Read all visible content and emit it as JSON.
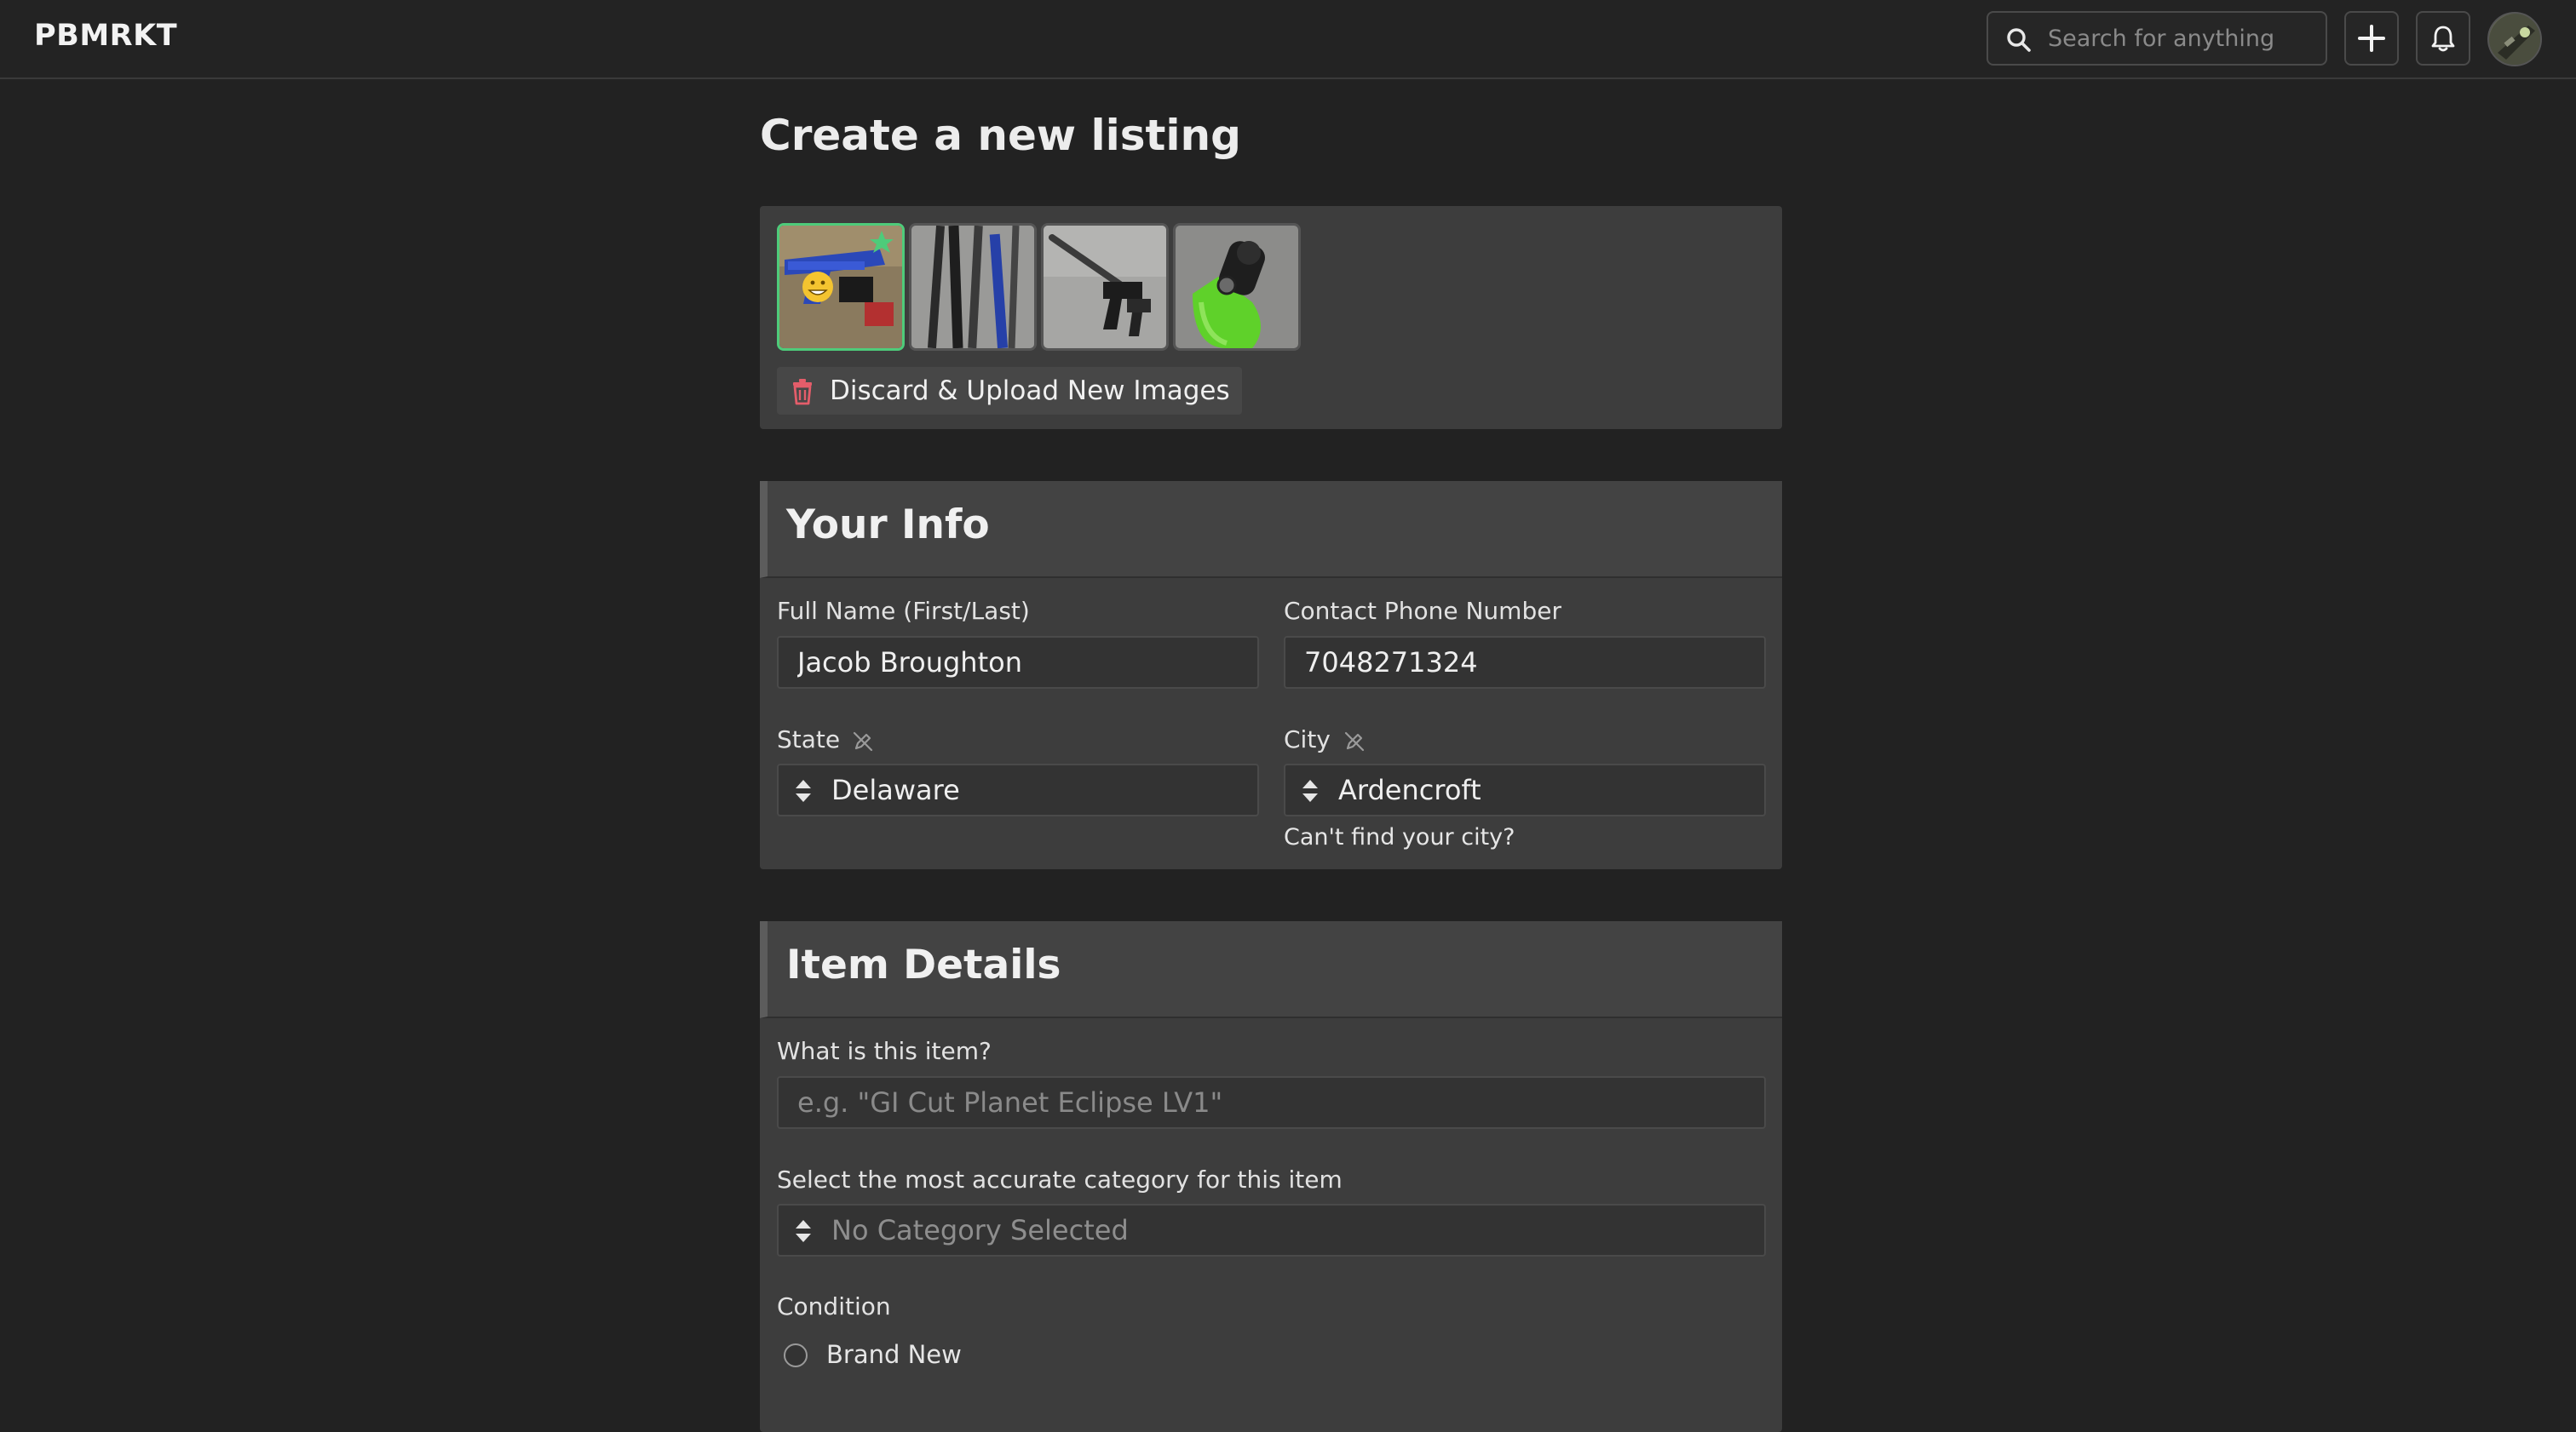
{
  "app": {
    "brand": "PBMRKT"
  },
  "header": {
    "search_placeholder": "Search for anything",
    "add_icon": "plus-icon",
    "notifications_icon": "bell-icon"
  },
  "page": {
    "title": "Create a new listing"
  },
  "images": {
    "count": 4,
    "discard_label": "Discard & Upload New Images",
    "primary_badge_icon": "star-icon"
  },
  "your_info": {
    "heading": "Your Info",
    "full_name_label": "Full Name (First/Last)",
    "full_name_value": "Jacob Broughton",
    "phone_label": "Contact Phone Number",
    "phone_value": "7048271324",
    "state_label": "State",
    "state_value": "Delaware",
    "city_label": "City",
    "city_value": "Ardencroft",
    "cant_find_city": "Can't find your city?"
  },
  "item_details": {
    "heading": "Item Details",
    "what_label": "What is this item?",
    "what_placeholder": "e.g. \"GI Cut Planet Eclipse LV1\"",
    "category_label": "Select the most accurate category for this item",
    "category_value": "No Category Selected",
    "condition_label": "Condition",
    "condition_options": [
      "Brand New"
    ]
  },
  "colors": {
    "background": "#222222",
    "panel": "#3d3d3d",
    "primary_highlight": "#4ecb7a",
    "danger": "#e35d6a"
  }
}
